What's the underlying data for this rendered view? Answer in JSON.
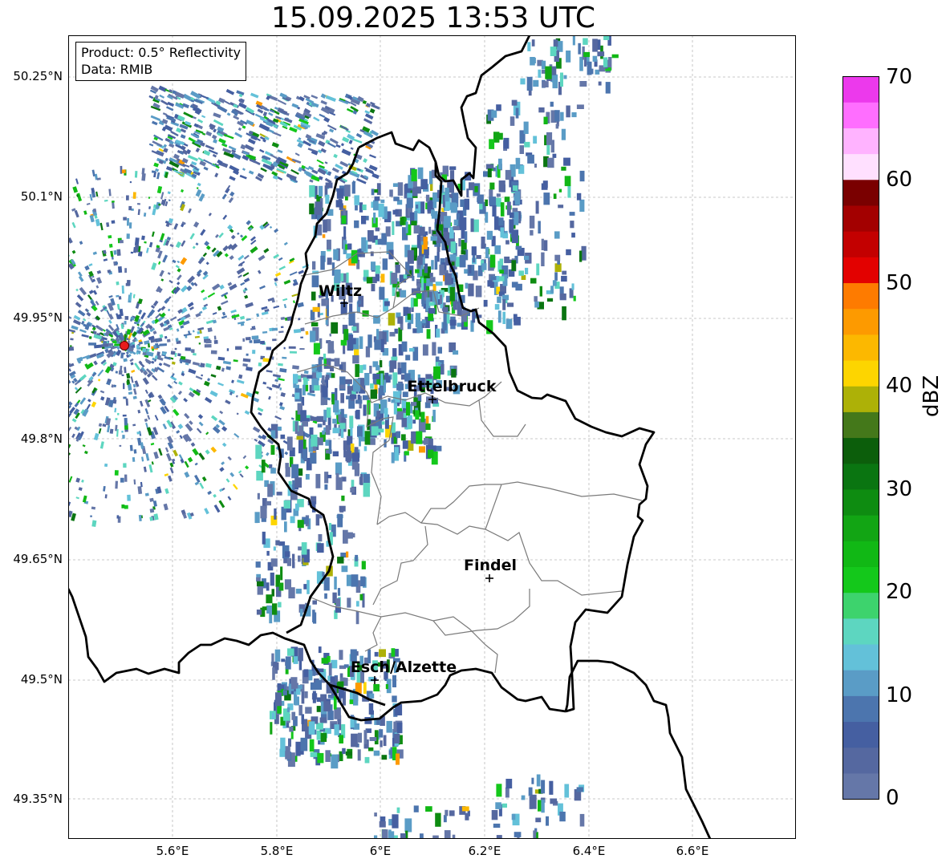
{
  "title": "15.09.2025 13:53 UTC",
  "info_box": {
    "product": "Product: 0.5° Reflectivity",
    "data": "Data: RMIB"
  },
  "y_axis_labels": [
    "50.25°N",
    "50.1°N",
    "49.95°N",
    "49.8°N",
    "49.65°N",
    "49.5°N",
    "49.35°N"
  ],
  "x_axis_labels": [
    "5.6°E",
    "5.8°E",
    "6°E",
    "6.2°E",
    "6.4°E",
    "6.6°E"
  ],
  "cities": [
    {
      "name": "Wiltz"
    },
    {
      "name": "Ettelbruck"
    },
    {
      "name": "Findel"
    },
    {
      "name": "Esch/Alzette"
    }
  ],
  "colorbar": {
    "label": "dBZ",
    "ticks": [
      "70",
      "60",
      "50",
      "40",
      "30",
      "20",
      "10",
      "0"
    ],
    "colors": [
      "#6577a8",
      "#5568a0",
      "#455fa1",
      "#4c75ae",
      "#5a9cc6",
      "#63c1d9",
      "#5dd6c0",
      "#3dd36d",
      "#14c81b",
      "#11b815",
      "#12a514",
      "#0e8c11",
      "#0a7511",
      "#0c5e0b",
      "#44781a",
      "#adb107",
      "#fdd500",
      "#fcb800",
      "#fd9a00",
      "#fe7b00",
      "#e30100",
      "#c30000",
      "#a30000",
      "#7a0000",
      "#ffe0ff",
      "#ffb3ff",
      "#ff6eff",
      "#ec39ec"
    ]
  },
  "radar_site_color": "#e81c1c"
}
